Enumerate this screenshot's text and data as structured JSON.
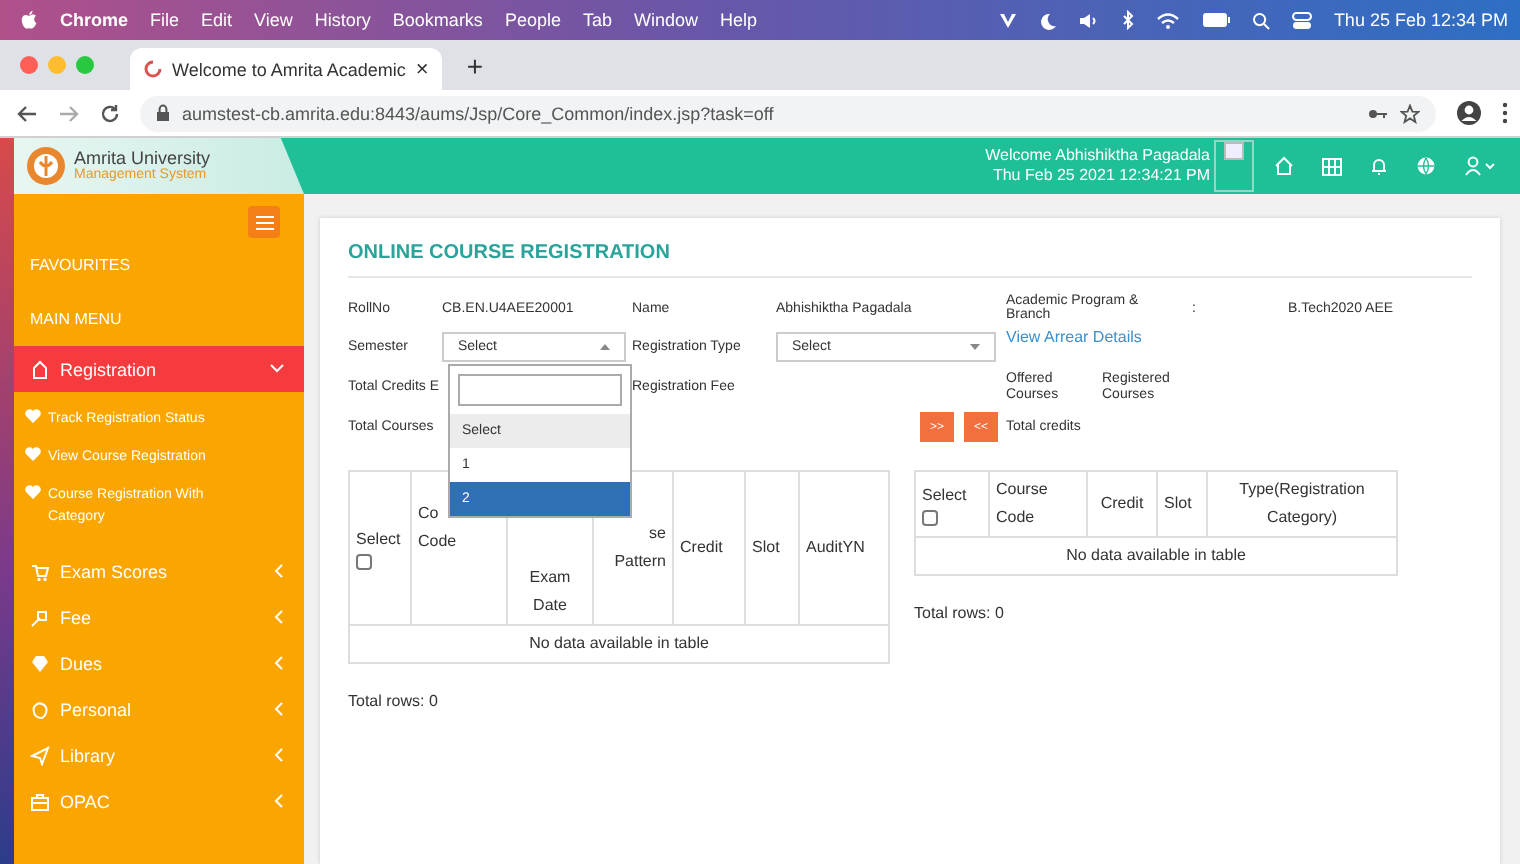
{
  "menubar": {
    "items": [
      {
        "label": "Chrome",
        "kind": "app"
      },
      {
        "label": "File",
        "kind": "menu"
      },
      {
        "label": "Edit",
        "kind": "menu"
      },
      {
        "label": "View",
        "kind": "menu"
      },
      {
        "label": "History",
        "kind": "menu"
      },
      {
        "label": "Bookmarks",
        "kind": "menu"
      },
      {
        "label": "People",
        "kind": "menu"
      },
      {
        "label": "Tab",
        "kind": "menu"
      },
      {
        "label": "Window",
        "kind": "menu"
      },
      {
        "label": "Help",
        "kind": "menu"
      }
    ],
    "clock": "Thu 25 Feb 12:34 PM"
  },
  "browser": {
    "tab": {
      "title": "Welcome to Amrita Academic",
      "close": "×"
    },
    "new_tab": "+",
    "url": "aumstest-cb.amrita.edu:8443/aums/Jsp/Core_Common/index.jsp?task=off"
  },
  "header": {
    "logo_title": "Amrita University",
    "logo_subtitle": "Management System",
    "welcome": "Welcome Abhishiktha Pagadala",
    "datetime": "Thu Feb 25 2021 12:34:21 PM"
  },
  "sidebar": {
    "sections": [
      "FAVOURITES",
      "MAIN MENU"
    ],
    "items": [
      {
        "label": "Registration",
        "selected": true,
        "expanded": true,
        "children": [
          {
            "label": "Track Registration Status"
          },
          {
            "label": "View Course Registration"
          },
          {
            "label": "Course Registration With Category"
          }
        ]
      },
      {
        "label": "Exam Scores",
        "selected": false,
        "expanded": false
      },
      {
        "label": "Fee",
        "selected": false,
        "expanded": false
      },
      {
        "label": "Dues",
        "selected": false,
        "expanded": false
      },
      {
        "label": "Personal",
        "selected": false,
        "expanded": false
      },
      {
        "label": "Library",
        "selected": false,
        "expanded": false
      },
      {
        "label": "OPAC",
        "selected": false,
        "expanded": false
      }
    ]
  },
  "form": {
    "title": "ONLINE COURSE REGISTRATION",
    "roll_label": "RollNo",
    "roll": "CB.EN.U4AEE20001",
    "name_label": "Name",
    "name": "Abhishiktha Pagadala",
    "program_label": "Academic Program & Branch",
    "program_sep": ":",
    "program": "B.Tech2020 AEE",
    "semester_label": "Semester",
    "semester": {
      "value": "Select",
      "expanded": true,
      "options": [
        {
          "label": "Select",
          "selected": true,
          "highlighted": false
        },
        {
          "label": "1",
          "selected": false,
          "highlighted": false
        },
        {
          "label": "2",
          "selected": false,
          "highlighted": true
        }
      ]
    },
    "reg_type_label": "Registration Type",
    "reg_type": {
      "value": "Select",
      "expanded": false
    },
    "arrear_link": "View Arrear Details",
    "credits_label": "Total Credits E",
    "fee_label": "Registration Fee",
    "courses_label": "Total Courses",
    "add_button": ">>",
    "remove_button": "<<",
    "offered_label": "Offered Courses",
    "registered_label": "Registered Courses",
    "total_credits_label": "Total credits"
  },
  "available_table": {
    "columns": [
      {
        "lines": [
          "Select"
        ],
        "checkbox": true,
        "checked": false
      },
      {
        "lines": [
          "Co",
          "Code"
        ],
        "checkbox": false
      },
      {
        "lines": [
          "Exam",
          "Date"
        ],
        "checkbox": false
      },
      {
        "lines": [
          "se",
          "Pattern"
        ],
        "checkbox": false
      },
      {
        "lines": [
          "Credit"
        ],
        "checkbox": false
      },
      {
        "lines": [
          "Slot"
        ],
        "checkbox": false
      },
      {
        "lines": [
          "AuditYN"
        ],
        "checkbox": false
      }
    ],
    "empty_message": "No data available in table",
    "total": "Total rows: 0"
  },
  "registered_table": {
    "columns": [
      {
        "lines": [
          "Select"
        ],
        "checkbox": true,
        "checked": false
      },
      {
        "lines": [
          "Course",
          "Code"
        ],
        "checkbox": false
      },
      {
        "lines": [
          "Credit"
        ],
        "checkbox": false
      },
      {
        "lines": [
          "Slot"
        ],
        "checkbox": false
      },
      {
        "lines": [
          "Type(Registration",
          "Category)"
        ],
        "checkbox": false
      }
    ],
    "empty_message": "No data available in table",
    "total": "Total rows: 0"
  }
}
